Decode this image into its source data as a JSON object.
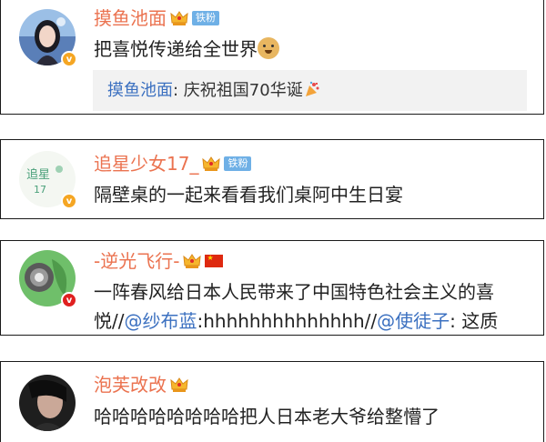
{
  "comments": [
    {
      "username": "摸鱼池面",
      "fan_tag": "铁粉",
      "text_before": "把喜悦传递给全世界",
      "emoji": "doge-emoji",
      "quote": {
        "name": "摸鱼池面",
        "separator": ": ",
        "text": "庆祝祖国70华诞",
        "emoji": "party-emoji"
      }
    },
    {
      "username": "追星少女17_",
      "fan_tag": "铁粉",
      "text": "隔壁桌的一起来看看我们桌阿中生日宴"
    },
    {
      "username": "-逆光飞行-",
      "flag": "china-flag-icon",
      "line1": "一阵春风给日本人民带来了中国特色社会主义的喜",
      "line2_a": "悦//",
      "mention1": "@纱布蓝",
      "line2_b": ":hhhhhhhhhhhhhh//",
      "mention2": "@使徒子",
      "line2_c": ": 这质"
    },
    {
      "username": "泡芙改改",
      "text": "哈哈哈哈哈哈哈哈把人日本老大爷给整懵了"
    }
  ],
  "colors": {
    "username": "#eb7350",
    "link": "#3b70c0",
    "verified_gold": "#f5a623",
    "verified_red": "#e02020",
    "tag": "#6fb0e6"
  }
}
